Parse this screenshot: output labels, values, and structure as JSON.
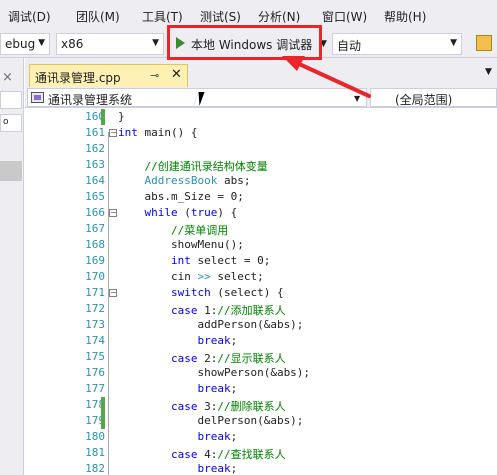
{
  "menu": [
    "调试(D)",
    "团队(M)",
    "工具(T)",
    "测试(S)",
    "分析(N)",
    "窗口(W)",
    "帮助(H)"
  ],
  "toolbar": {
    "config": "ebug",
    "platform": "x86",
    "run_label": "本地 Windows 调试器",
    "solution_config": "自动"
  },
  "tab": {
    "label": "通讯录管理.cpp"
  },
  "navbar": {
    "scope": "通讯录管理系统",
    "member": "(全局范围)"
  },
  "left_panel": {
    "combo": "o"
  },
  "editor": {
    "lines": [
      {
        "num": "160",
        "changed": true,
        "tokens": [
          {
            "t": "}",
            "c": ""
          }
        ]
      },
      {
        "num": "161",
        "changed": false,
        "outline": "−",
        "tokens": [
          {
            "t": "int",
            "c": "kw"
          },
          {
            "t": " main() {",
            "c": ""
          }
        ]
      },
      {
        "num": "162",
        "changed": false,
        "tokens": []
      },
      {
        "num": "163",
        "changed": false,
        "tokens": [
          {
            "t": "    //创建通讯录结构体变量",
            "c": "cm"
          }
        ]
      },
      {
        "num": "164",
        "changed": false,
        "tokens": [
          {
            "t": "    ",
            "c": ""
          },
          {
            "t": "AddressBook",
            "c": "ty"
          },
          {
            "t": " abs;",
            "c": ""
          }
        ]
      },
      {
        "num": "165",
        "changed": false,
        "tokens": [
          {
            "t": "    abs.m_Size = 0;",
            "c": ""
          }
        ]
      },
      {
        "num": "166",
        "changed": false,
        "outline": "−",
        "tokens": [
          {
            "t": "    ",
            "c": ""
          },
          {
            "t": "while",
            "c": "kw"
          },
          {
            "t": " (",
            "c": ""
          },
          {
            "t": "true",
            "c": "kw"
          },
          {
            "t": ") {",
            "c": ""
          }
        ]
      },
      {
        "num": "167",
        "changed": false,
        "tokens": [
          {
            "t": "        //菜单调用",
            "c": "cm"
          }
        ]
      },
      {
        "num": "168",
        "changed": false,
        "tokens": [
          {
            "t": "        showMenu();",
            "c": ""
          }
        ]
      },
      {
        "num": "169",
        "changed": false,
        "tokens": [
          {
            "t": "        ",
            "c": ""
          },
          {
            "t": "int",
            "c": "kw"
          },
          {
            "t": " select = 0;",
            "c": ""
          }
        ]
      },
      {
        "num": "170",
        "changed": false,
        "tokens": [
          {
            "t": "        cin ",
            "c": ""
          },
          {
            "t": ">>",
            "c": "ty"
          },
          {
            "t": " select;",
            "c": ""
          }
        ]
      },
      {
        "num": "171",
        "changed": false,
        "outline": "−",
        "tokens": [
          {
            "t": "        ",
            "c": ""
          },
          {
            "t": "switch",
            "c": "kw"
          },
          {
            "t": " (select) {",
            "c": ""
          }
        ]
      },
      {
        "num": "172",
        "changed": false,
        "tokens": [
          {
            "t": "        ",
            "c": ""
          },
          {
            "t": "case",
            "c": "kw"
          },
          {
            "t": " 1:",
            "c": ""
          },
          {
            "t": "//添加联系人",
            "c": "cm"
          }
        ]
      },
      {
        "num": "173",
        "changed": false,
        "tokens": [
          {
            "t": "            addPerson(&abs);",
            "c": ""
          }
        ]
      },
      {
        "num": "174",
        "changed": false,
        "tokens": [
          {
            "t": "            ",
            "c": ""
          },
          {
            "t": "break",
            "c": "kw"
          },
          {
            "t": ";",
            "c": ""
          }
        ]
      },
      {
        "num": "175",
        "changed": false,
        "tokens": [
          {
            "t": "        ",
            "c": ""
          },
          {
            "t": "case",
            "c": "kw"
          },
          {
            "t": " 2:",
            "c": ""
          },
          {
            "t": "//显示联系人",
            "c": "cm"
          }
        ]
      },
      {
        "num": "176",
        "changed": false,
        "tokens": [
          {
            "t": "            showPerson(&abs);",
            "c": ""
          }
        ]
      },
      {
        "num": "177",
        "changed": false,
        "tokens": [
          {
            "t": "            ",
            "c": ""
          },
          {
            "t": "break",
            "c": "kw"
          },
          {
            "t": ";",
            "c": ""
          }
        ]
      },
      {
        "num": "178",
        "changed": true,
        "tokens": [
          {
            "t": "        ",
            "c": ""
          },
          {
            "t": "case",
            "c": "kw"
          },
          {
            "t": " 3:",
            "c": ""
          },
          {
            "t": "//删除联系人",
            "c": "cm"
          }
        ]
      },
      {
        "num": "179",
        "changed": true,
        "tokens": [
          {
            "t": "            delPerson(&abs);",
            "c": ""
          }
        ]
      },
      {
        "num": "180",
        "changed": false,
        "tokens": [
          {
            "t": "            ",
            "c": ""
          },
          {
            "t": "break",
            "c": "kw"
          },
          {
            "t": ";",
            "c": ""
          }
        ]
      },
      {
        "num": "181",
        "changed": false,
        "tokens": [
          {
            "t": "        ",
            "c": ""
          },
          {
            "t": "case",
            "c": "kw"
          },
          {
            "t": " 4:",
            "c": ""
          },
          {
            "t": "//查找联系人",
            "c": "cm"
          }
        ]
      },
      {
        "num": "182",
        "changed": false,
        "tokens": [
          {
            "t": "            ",
            "c": ""
          },
          {
            "t": "break",
            "c": "kw"
          },
          {
            "t": ";",
            "c": ""
          }
        ]
      }
    ]
  },
  "colors": {
    "highlight_box": "#e8262c",
    "arrow": "#e8262c",
    "keyword": "#0000ff",
    "comment": "#008000",
    "type": "#2b91af",
    "line_number": "#2b91af",
    "change_bar": "#57a64a",
    "active_tab": "#fff0b3"
  },
  "icons": {
    "run": "play-icon",
    "tab_pin": "pin-icon",
    "tab_close": "close-icon",
    "scope": "class-icon",
    "cursor": "mouse-pointer-icon",
    "toolbar_extra": "folder-icon"
  }
}
